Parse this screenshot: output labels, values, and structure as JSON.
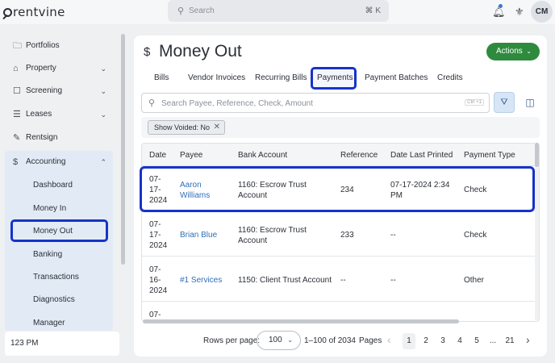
{
  "app": {
    "logo_text": "rentvine",
    "search_placeholder": "Search",
    "search_shortcut": "⌘ K",
    "user_initials": "CM"
  },
  "sidebar": {
    "items": [
      {
        "label": "Portfolios",
        "icon": "folders-icon"
      },
      {
        "label": "Property",
        "icon": "building-icon"
      },
      {
        "label": "Screening",
        "icon": "screening-icon"
      },
      {
        "label": "Leases",
        "icon": "document-icon"
      },
      {
        "label": "Rentsign",
        "icon": "signature-icon"
      },
      {
        "label": "Accounting",
        "icon": "dollar-icon"
      }
    ],
    "accounting_subitems": [
      "Dashboard",
      "Money In",
      "Money Out",
      "Banking",
      "Transactions",
      "Diagnostics",
      "Manager"
    ],
    "selected": "Money Out",
    "clock": "123 PM"
  },
  "page": {
    "title": "Money Out",
    "actions_label": "Actions",
    "tabs": [
      "Bills",
      "Vendor Invoices",
      "Recurring Bills",
      "Payments",
      "Payment Batches",
      "Credits"
    ],
    "active_tab": "Payments",
    "filter_placeholder": "Search Payee, Reference, Check, Amount",
    "filter_shortcut": "Ctrl +1",
    "chip": "Show Voided: No"
  },
  "table": {
    "headers": [
      "Date",
      "Payee",
      "Bank Account",
      "Reference",
      "Date Last Printed",
      "Payment Type"
    ],
    "rows": [
      {
        "date_l1": "07-",
        "date_l2": "17-",
        "date_l3": "2024",
        "payee_l1": "Aaron",
        "payee_l2": "Williams",
        "bank_l1": "1160: Escrow Trust",
        "bank_l2": "Account",
        "reference": "234",
        "printed_l1": "07-17-2024 2:34",
        "printed_l2": "PM",
        "type": "Check"
      },
      {
        "date_l1": "07-",
        "date_l2": "17-",
        "date_l3": "2024",
        "payee_l1": "Brian Blue",
        "payee_l2": "",
        "bank_l1": "1160: Escrow Trust",
        "bank_l2": "Account",
        "reference": "233",
        "printed_l1": "--",
        "printed_l2": "",
        "type": "Check"
      },
      {
        "date_l1": "07-",
        "date_l2": "16-",
        "date_l3": "2024",
        "payee_l1": "#1 Services",
        "payee_l2": "",
        "bank_l1": "1150: Client Trust Account",
        "bank_l2": "",
        "reference": "--",
        "printed_l1": "--",
        "printed_l2": "",
        "type": "Other"
      },
      {
        "date_l1": "07-",
        "date_l2": "",
        "date_l3": "",
        "payee_l1": "",
        "payee_l2": "",
        "bank_l1": "",
        "bank_l2": "",
        "reference": "",
        "printed_l1": "",
        "printed_l2": "",
        "type": ""
      }
    ]
  },
  "pagination": {
    "rows_per_page_label": "Rows per page:",
    "rows_per_page": "100",
    "range": "1–100 of 2034",
    "pages_label": "Pages",
    "pages": [
      "1",
      "2",
      "3",
      "4",
      "5",
      "...",
      "21"
    ],
    "current_page": "1"
  },
  "colors": {
    "accent": "#1633c9",
    "action_green": "#2e8b3e",
    "link_blue": "#2f6fb8"
  }
}
